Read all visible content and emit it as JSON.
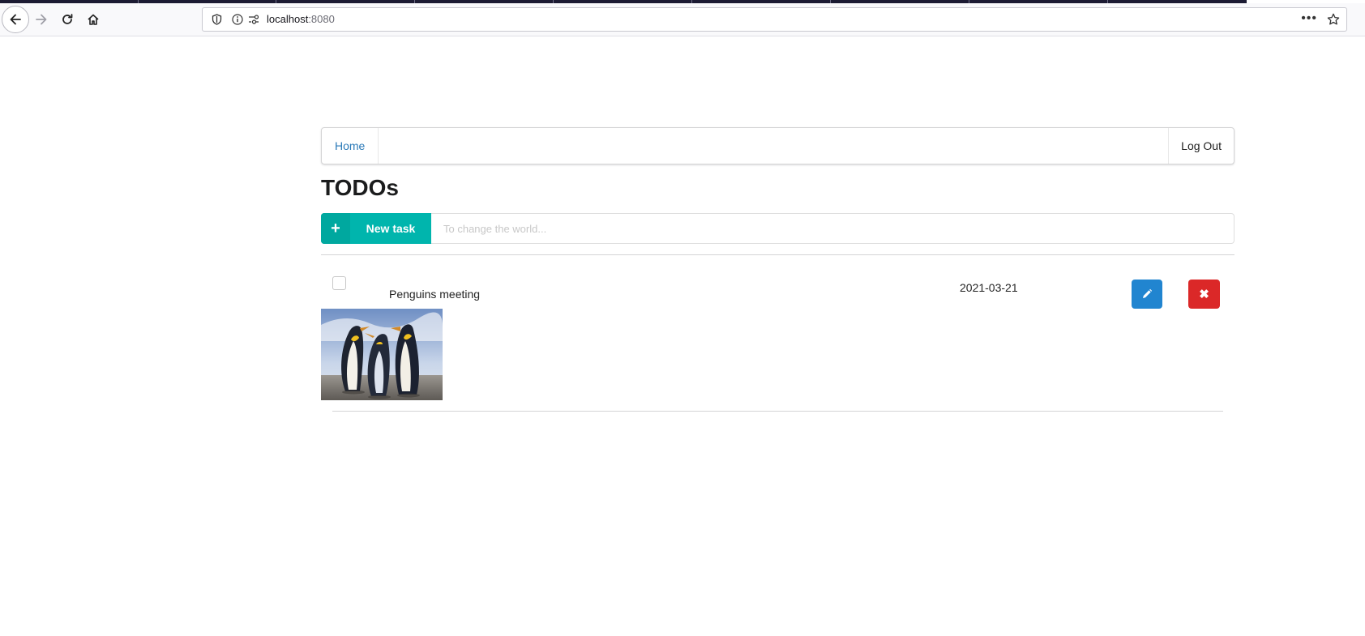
{
  "browser": {
    "url_host": "localhost",
    "url_port": ":8080",
    "more_label": "•••"
  },
  "nav": {
    "home_label": "Home",
    "logout_label": "Log Out"
  },
  "page_title": "TODOs",
  "new_task": {
    "button_label": "New task",
    "plus_icon": "+",
    "placeholder": "To change the world..."
  },
  "todos": [
    {
      "name": "Penguins meeting",
      "date": "2021-03-21",
      "checked": false,
      "delete_icon": "✖"
    }
  ],
  "colors": {
    "teal": "#00b5ad",
    "blue": "#2185d0",
    "red": "#db2828",
    "link": "#2b7ab8"
  }
}
